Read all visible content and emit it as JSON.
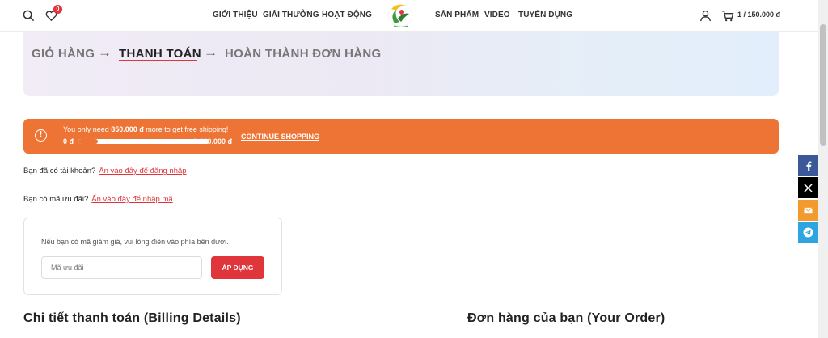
{
  "header": {
    "wishlist_count": "0",
    "nav_left": [
      "GIỚI THIỆU",
      "GIẢI THƯỞNG",
      "HOẠT ĐỘNG"
    ],
    "nav_right": [
      "SẢN PHẨM",
      "VIDEO",
      "TUYỂN DỤNG"
    ],
    "cart_total": "1 / 150.000 đ",
    "icons": [
      "search-icon",
      "heart-icon",
      "user-icon",
      "cart-icon"
    ]
  },
  "breadcrumb": {
    "step1": "GIỎ HÀNG",
    "step2": "THANH TOÁN",
    "step3": "HOÀN THÀNH ĐƠN HÀNG",
    "arrow": "→"
  },
  "shipping_notice": {
    "prefix": "You only need",
    "amount": "850.000 đ",
    "suffix": "more to get free shipping!",
    "min_label": "0 đ",
    "max_label": "1.000.000 đ",
    "progress": 0.15,
    "continue_label": "CONTINUE SHOPPING",
    "info_glyph": "!"
  },
  "login": {
    "question": "Bạn đã có tài khoản?",
    "link": "Ấn vào đây để đăng nhập"
  },
  "coupon": {
    "question": "Bạn có mã ưu đãi?",
    "link": "Ấn vào đây để nhập mã",
    "hint": "Nếu bạn có mã giảm giá, vui lòng điền vào phía bên dưới.",
    "placeholder": "Mã ưu đãi",
    "button": "ÁP DỤNG"
  },
  "sections": {
    "billing_title": "Chi tiết thanh toán (Billing Details)",
    "order_title": "Đơn hàng của bạn (Your Order)"
  },
  "colors": {
    "accent": "#e0353b",
    "notice": "#ee7436",
    "facebook": "#3b5998",
    "x": "#000000",
    "email": "#f29a2e",
    "telegram": "#2ca5e0"
  }
}
